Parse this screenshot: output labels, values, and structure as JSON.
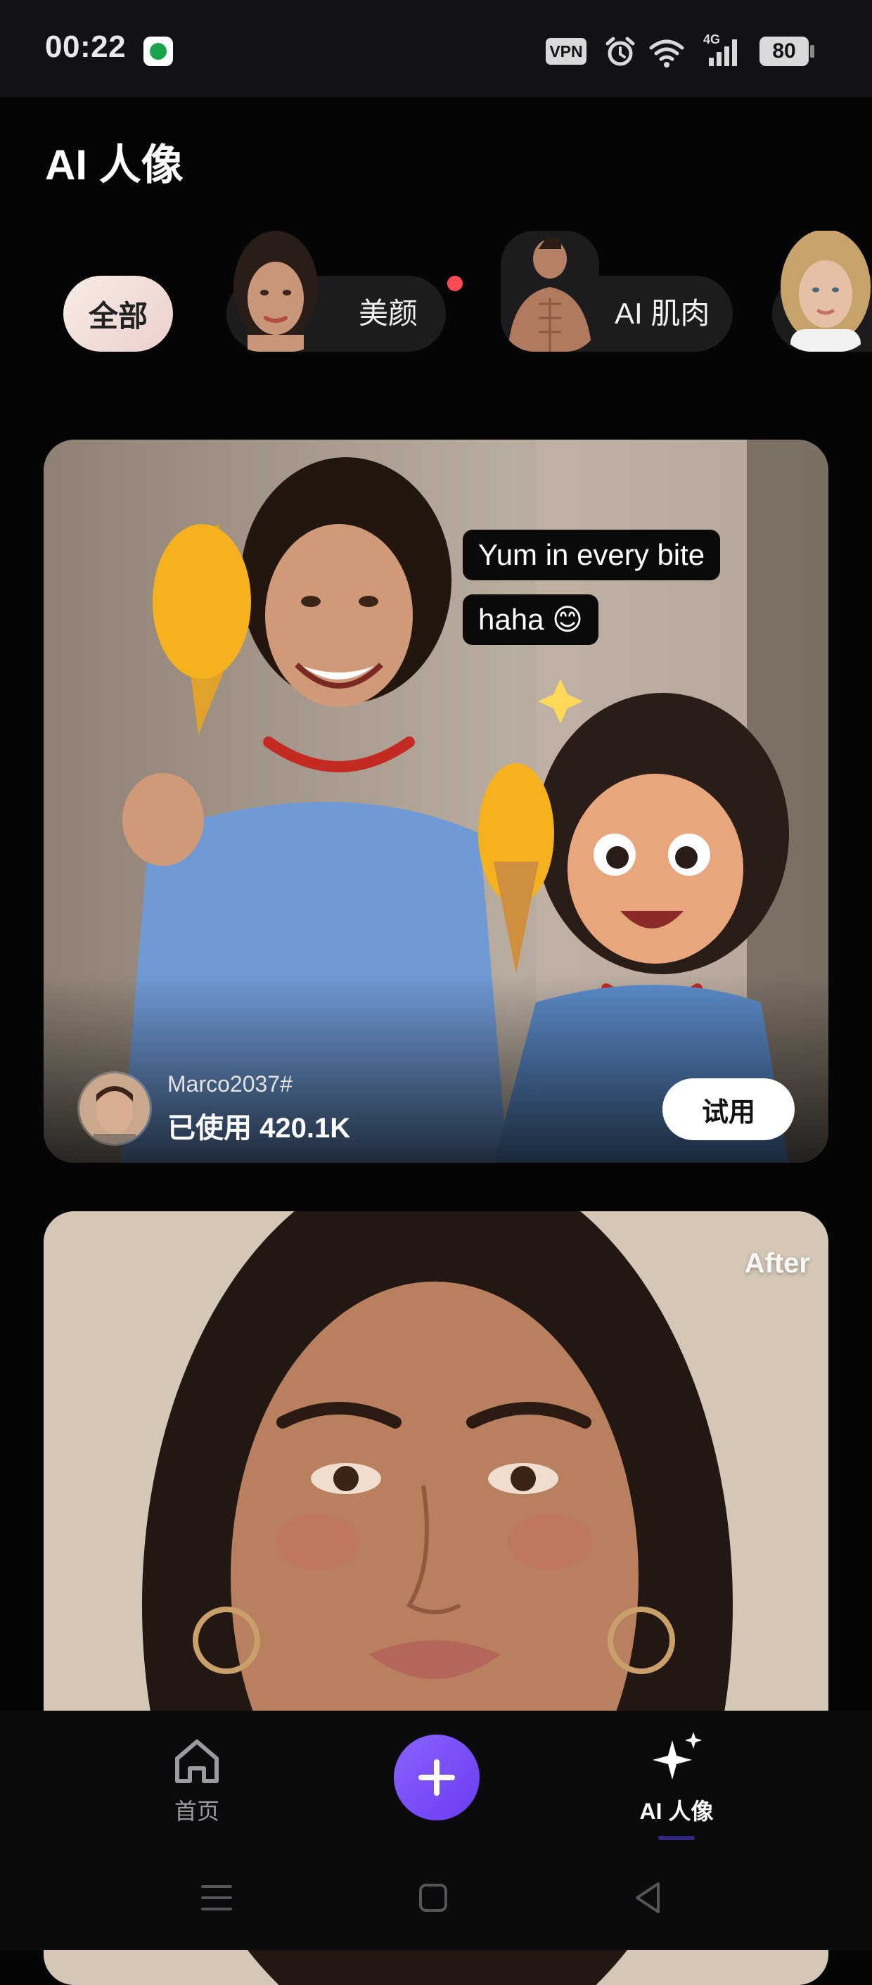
{
  "status_bar": {
    "time": "00:22",
    "vpn": "VPN",
    "network": "4G",
    "battery": "80"
  },
  "page": {
    "title": "AI 人像"
  },
  "categories": [
    {
      "label": "全部",
      "selected": true
    },
    {
      "label": "美颜",
      "has_dot": true
    },
    {
      "label": "AI 肌肉"
    }
  ],
  "cards": [
    {
      "captions": [
        "Yum in every bite",
        "haha 😊"
      ],
      "creator": "Marco2037#",
      "usage": "已使用 420.1K",
      "action": "试用"
    },
    {
      "badge": "After"
    }
  ],
  "bottom_nav": {
    "items": [
      {
        "label": "首页",
        "icon": "home-icon",
        "active": false
      },
      {
        "label": "",
        "icon": "plus-icon"
      },
      {
        "label": "AI 人像",
        "icon": "sparkle-icon",
        "active": true
      }
    ]
  },
  "colors": {
    "accent": "#7b4dff",
    "background": "#050505",
    "chip_dark": "#1c1c1f",
    "dot": "#ff4a55"
  }
}
